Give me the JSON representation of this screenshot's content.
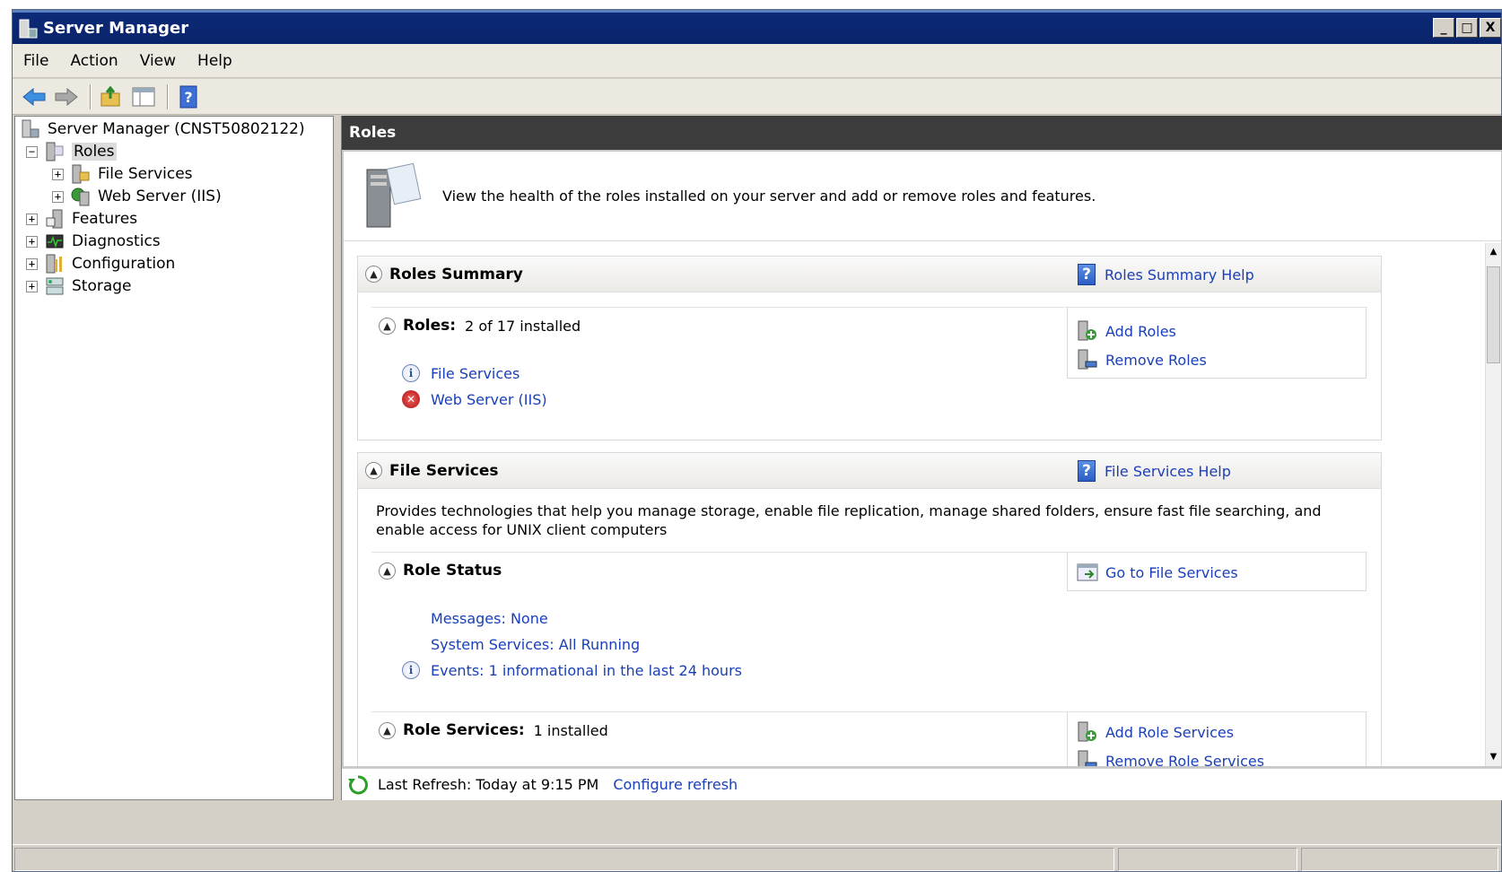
{
  "window": {
    "title": "Server Manager",
    "buttons": [
      "_",
      "□",
      "X"
    ]
  },
  "menu": [
    "File",
    "Action",
    "View",
    "Help"
  ],
  "toolbar": [
    "back-arrow-icon",
    "forward-arrow-icon",
    "up-folder-icon",
    "show-hide-tree-icon",
    "help-icon"
  ],
  "tree": {
    "root": "Server Manager (CNST50802122)",
    "items": [
      {
        "label": "Roles",
        "toggle": "−",
        "icon": "roles-icon",
        "selected": true
      },
      {
        "label": "File Services",
        "toggle": "+",
        "icon": "file-services-icon"
      },
      {
        "label": "Web Server (IIS)",
        "toggle": "+",
        "icon": "web-server-icon"
      },
      {
        "label": "Features",
        "toggle": "+",
        "icon": "features-icon"
      },
      {
        "label": "Diagnostics",
        "toggle": "+",
        "icon": "diagnostics-icon"
      },
      {
        "label": "Configuration",
        "toggle": "+",
        "icon": "configuration-icon"
      },
      {
        "label": "Storage",
        "toggle": "+",
        "icon": "storage-icon"
      }
    ]
  },
  "content": {
    "header": "Roles",
    "intro": "View the health of the roles installed on your server and add or remove roles and features.",
    "roles_summary": {
      "title": "Roles Summary",
      "help": "Roles Summary Help",
      "roles_label": "Roles:",
      "roles_count": "2 of 17 installed",
      "roles": [
        {
          "name": "File Services",
          "status": "info"
        },
        {
          "name": "Web Server (IIS)",
          "status": "error"
        }
      ],
      "add_roles": "Add Roles",
      "remove_roles": "Remove Roles"
    },
    "file_services": {
      "title": "File Services",
      "help": "File Services Help",
      "description": "Provides technologies that help you manage storage, enable file replication, manage shared folders, ensure fast file searching, and enable access for UNIX client computers",
      "role_status": {
        "title": "Role Status",
        "go_to": "Go to File Services",
        "messages": "Messages: None",
        "services": "System Services: All Running",
        "events": "Events: 1 informational in the last 24 hours"
      },
      "role_services": {
        "title": "Role Services:",
        "count": "1 installed",
        "add": "Add Role Services",
        "remove": "Remove Role Services"
      }
    },
    "refresh": {
      "last": "Last Refresh: Today at 9:15 PM",
      "configure": "Configure refresh"
    }
  },
  "colors": {
    "link": "#1a3fb8",
    "header_dark": "#3c3c3c",
    "titlebar": "#0a246a"
  }
}
